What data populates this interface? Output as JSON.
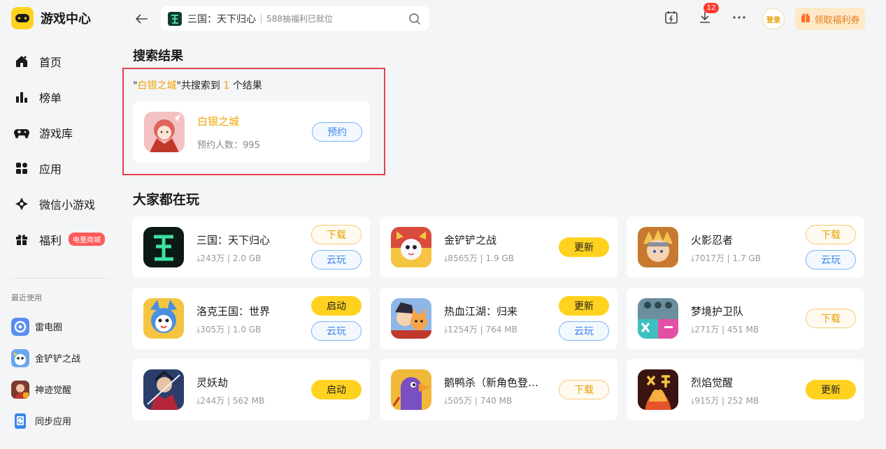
{
  "app": {
    "title": "游戏中心"
  },
  "sidebar": {
    "items": [
      {
        "label": "首页",
        "icon": "home-icon"
      },
      {
        "label": "榜单",
        "icon": "ranking-icon"
      },
      {
        "label": "游戏库",
        "icon": "gamepad-icon"
      },
      {
        "label": "应用",
        "icon": "apps-icon"
      },
      {
        "label": "微信小游戏",
        "icon": "mini-game-icon"
      },
      {
        "label": "福利",
        "icon": "gift-icon",
        "badge": "电量商城"
      }
    ],
    "recent_title": "最近使用",
    "recent": [
      {
        "label": "雷电圈"
      },
      {
        "label": "金铲铲之战"
      },
      {
        "label": "神迹觉醒"
      },
      {
        "label": "同步应用"
      }
    ]
  },
  "topbar": {
    "search_text": "三国：天下归心",
    "search_hint": "588抽福利已就位",
    "download_count": "12",
    "login_label": "登录",
    "welfare_label": "领取福利券"
  },
  "results": {
    "title": "搜索结果",
    "summary": {
      "prefix": "\"",
      "keyword": "白银之城",
      "middle": "\"共搜索到 ",
      "count": "1",
      "suffix": " 个结果"
    },
    "item": {
      "name": "白银之城",
      "meta": "预约人数：995",
      "button": "预约"
    }
  },
  "popular": {
    "title": "大家都在玩",
    "games": [
      {
        "name": "三国：天下归心",
        "meta": "⤓243万 | 2.0 GB",
        "buttons": [
          "下载",
          "云玩"
        ],
        "styles": [
          "orange",
          "blue"
        ]
      },
      {
        "name": "金铲铲之战",
        "meta": "⤓8565万 | 1.9 GB",
        "buttons": [
          "更新"
        ],
        "styles": [
          "yellow"
        ]
      },
      {
        "name": "火影忍者",
        "meta": "⤓7017万 | 1.7 GB",
        "buttons": [
          "下载",
          "云玩"
        ],
        "styles": [
          "orange",
          "blue"
        ]
      },
      {
        "name": "洛克王国：世界",
        "meta": "⤓305万 | 1.0 GB",
        "buttons": [
          "启动",
          "云玩"
        ],
        "styles": [
          "yellow",
          "blue"
        ]
      },
      {
        "name": "热血江湖：归来",
        "meta": "⤓1254万 | 764 MB",
        "buttons": [
          "更新",
          "云玩"
        ],
        "styles": [
          "yellow",
          "blue"
        ]
      },
      {
        "name": "梦境护卫队",
        "meta": "⤓271万 | 451 MB",
        "buttons": [
          "下载"
        ],
        "styles": [
          "orange"
        ]
      },
      {
        "name": "灵妖劫",
        "meta": "⤓244万 | 562 MB",
        "buttons": [
          "启动"
        ],
        "styles": [
          "yellow"
        ]
      },
      {
        "name": "鹅鸭杀（新角色登…",
        "meta": "⤓505万 | 740 MB",
        "buttons": [
          "下载"
        ],
        "styles": [
          "orange"
        ]
      },
      {
        "name": "烈焰觉醒",
        "meta": "⤓915万 | 252 MB",
        "buttons": [
          "更新"
        ],
        "styles": [
          "yellow"
        ]
      }
    ]
  },
  "colors": {
    "accent": "#ffd21f",
    "highlight": "#f0a300",
    "cloud_blue": "#3a86e8",
    "frame_red": "#e0434b"
  }
}
